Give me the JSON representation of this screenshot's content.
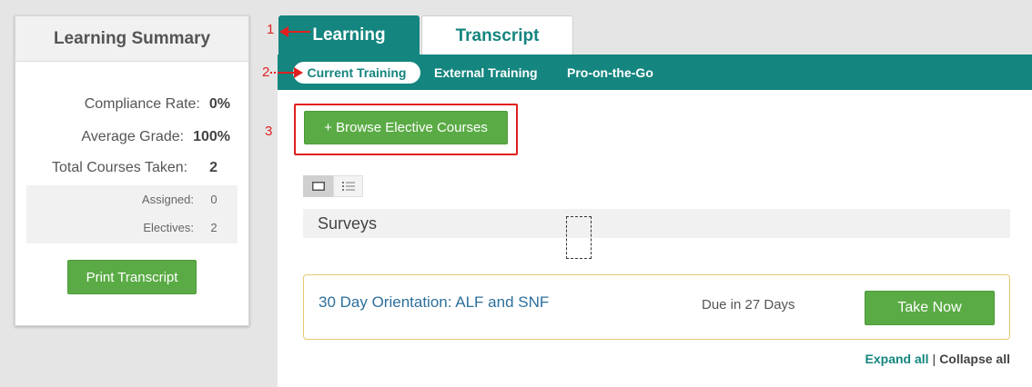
{
  "summary": {
    "title": "Learning Summary",
    "compliance_label": "Compliance Rate:",
    "compliance_value": "0%",
    "grade_label": "Average Grade:",
    "grade_value": "100%",
    "total_label": "Total Courses Taken:",
    "total_value": "2",
    "assigned_label": "Assigned:",
    "assigned_value": "0",
    "electives_label": "Electives:",
    "electives_value": "2",
    "print_label": "Print Transcript"
  },
  "annotations": [
    "1",
    "2",
    "3"
  ],
  "tabs": {
    "learning": "Learning",
    "transcript": "Transcript"
  },
  "subnav": {
    "current": "Current Training",
    "external": "External Training",
    "pro": "Pro-on-the-Go"
  },
  "browse_label": "+ Browse Elective Courses",
  "surveys_label": "Surveys",
  "course": {
    "title": "30 Day Orientation: ALF and SNF",
    "due": "Due in 27 Days",
    "action": "Take Now"
  },
  "expand_label": "Expand all",
  "separator": "|",
  "collapse_label": "Collapse all",
  "colors": {
    "teal": "#14857f",
    "green": "#5aab45",
    "annotation_red": "#e02020",
    "link_blue": "#2c6f9c"
  },
  "icons": {
    "card_view": "card-view-icon",
    "list_view": "list-view-icon"
  }
}
